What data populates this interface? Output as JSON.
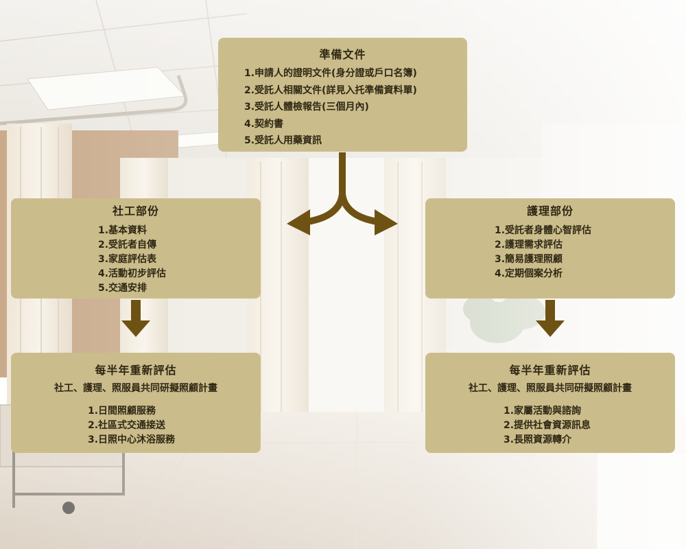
{
  "colors": {
    "box_fill": "#cbbd8b",
    "arrow": "#6e5214",
    "text": "#2f2714"
  },
  "prepare": {
    "title": "準備文件",
    "items": [
      "1.申請人的證明文件(身分證或戶口名簿)",
      "2.受託人相關文件(詳見入托準備資料單)",
      "3.受託人體檢報告(三個月內)",
      "4.契約書",
      "5.受託人用藥資訊"
    ]
  },
  "social": {
    "title": "社工部份",
    "items": [
      "1.基本資料",
      "2.受託者自傳",
      "3.家庭評估表",
      "4.活動初步評估",
      "5.交通安排"
    ]
  },
  "nursing": {
    "title": "護理部份",
    "items": [
      "1.受託者身體心智評估",
      "2.護理需求評估",
      "3.簡易護理照顧",
      "4.定期個案分析"
    ]
  },
  "review_left": {
    "title": "每半年重新評估",
    "subtitle": "社工、護理、照服員共同研擬照顧計畫",
    "items": [
      "1.日間照顧服務",
      "2.社區式交通接送",
      "3.日照中心沐浴服務"
    ]
  },
  "review_right": {
    "title": "每半年重新評估",
    "subtitle": "社工、護理、照服員共同研擬照顧計畫",
    "items": [
      "1.家屬活動與諮詢",
      "2.提供社會資源訊息",
      "3.長照資源轉介"
    ]
  }
}
